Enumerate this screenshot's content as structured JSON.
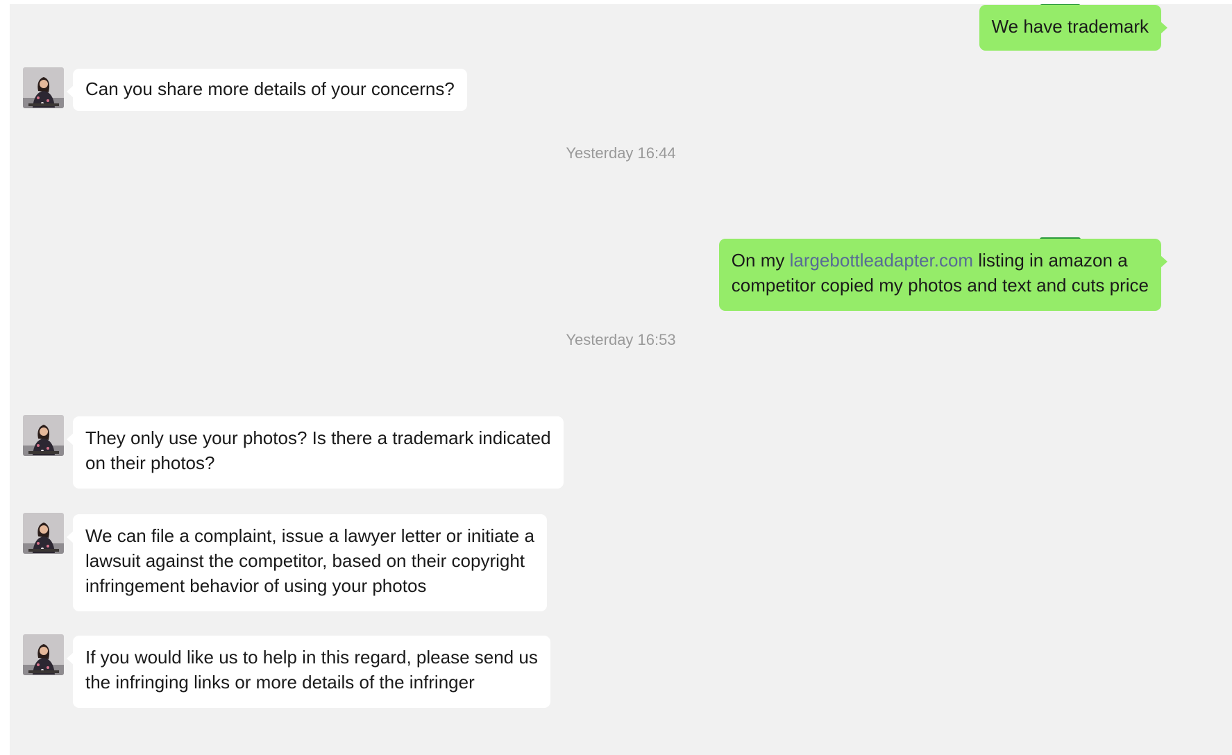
{
  "conversation": {
    "messages": [
      {
        "direction": "out",
        "text": "We have trademark"
      },
      {
        "direction": "in",
        "text": "Can you share more details of your concerns?"
      },
      {
        "type": "timestamp",
        "text": "Yesterday 16:44"
      },
      {
        "direction": "out",
        "line1_pre": "On my ",
        "line1_link": "largebottleadapter.com",
        "line1_post": " listing in amazon a",
        "line2": "competitor copied my photos and text and cuts price"
      },
      {
        "type": "timestamp",
        "text": "Yesterday 16:53"
      },
      {
        "direction": "in",
        "line1": "They only use your photos? Is there a trademark indicated",
        "line2": "on their photos?"
      },
      {
        "direction": "in",
        "line1": "We can file a complaint,  issue a lawyer letter or initiate a",
        "line2": "lawsuit against the competitor, based on their copyright",
        "line3": "infringement behavior of using your photos"
      },
      {
        "direction": "in",
        "line1": "If you would like us to help in this regard, please send us",
        "line2": "the infringing links or more details of the infringer"
      }
    ]
  },
  "colors": {
    "chat_background": "#f1f1f1",
    "incoming_bubble": "#ffffff",
    "outgoing_bubble": "#95ec69",
    "timestamp_text": "#9a9a9a",
    "link": "#576b95"
  },
  "icons": {
    "incoming_avatar": "woman-avatar-icon",
    "outgoing_avatar": "man-avatar-icon"
  }
}
